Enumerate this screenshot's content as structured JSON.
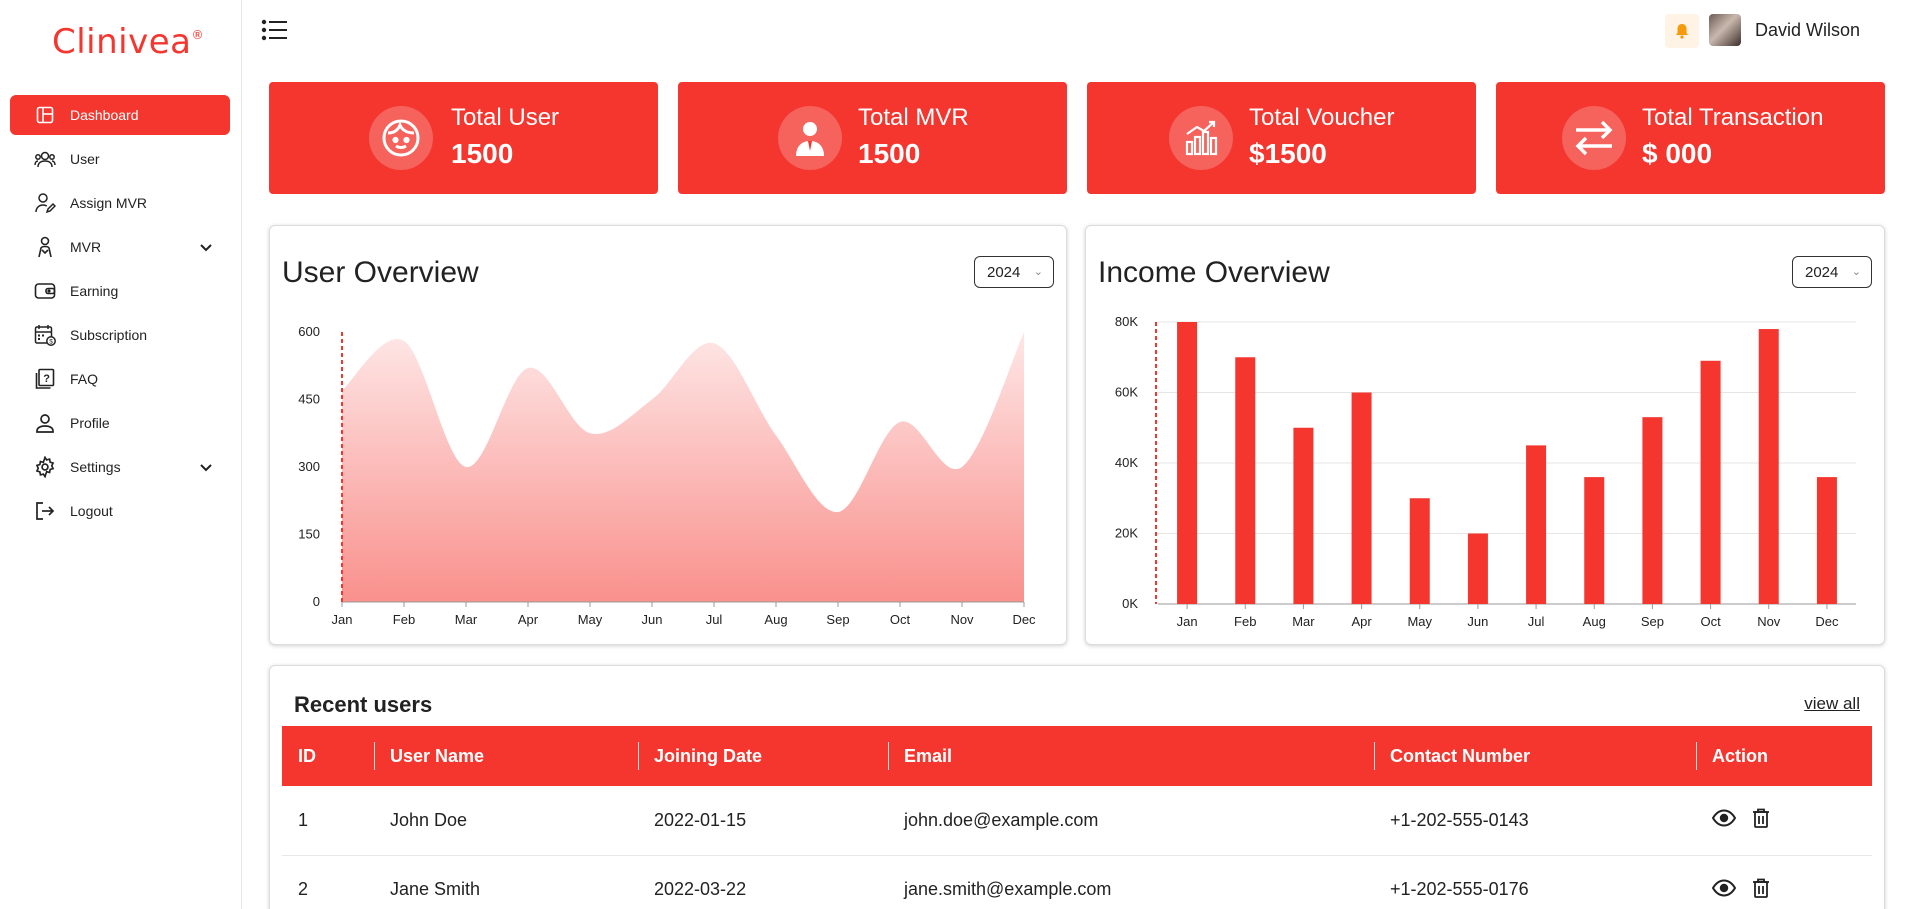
{
  "app": {
    "logo": "Clinivea",
    "logo_mark": "®"
  },
  "sidebar": {
    "items": [
      {
        "label": "Dashboard",
        "icon": "dashboard-icon",
        "active": true
      },
      {
        "label": "User",
        "icon": "users-icon"
      },
      {
        "label": "Assign MVR",
        "icon": "user-edit-icon"
      },
      {
        "label": "MVR",
        "icon": "person-icon",
        "expandable": true
      },
      {
        "label": "Earning",
        "icon": "wallet-icon"
      },
      {
        "label": "Subscription",
        "icon": "calendar-icon"
      },
      {
        "label": "FAQ",
        "icon": "help-book-icon"
      },
      {
        "label": "Profile",
        "icon": "profile-icon"
      },
      {
        "label": "Settings",
        "icon": "gear-icon",
        "expandable": true
      },
      {
        "label": "Logout",
        "icon": "logout-icon"
      }
    ]
  },
  "header": {
    "user_name": "David Wilson"
  },
  "stats": [
    {
      "label": "Total User",
      "value": "1500",
      "icon": "face-icon"
    },
    {
      "label": "Total MVR",
      "value": "1500",
      "icon": "businessman-icon"
    },
    {
      "label": "Total Voucher",
      "value": "$1500",
      "icon": "growth-chart-icon"
    },
    {
      "label": "Total Transaction",
      "value": "$ 000",
      "icon": "transfer-arrows-icon"
    }
  ],
  "user_overview": {
    "title": "User Overview",
    "year": "2024"
  },
  "income_overview": {
    "title": "Income Overview",
    "year": "2024"
  },
  "chart_data": [
    {
      "type": "area",
      "title": "User Overview",
      "x": [
        "Jan",
        "Feb",
        "Mar",
        "Apr",
        "May",
        "Jun",
        "Jul",
        "Aug",
        "Sep",
        "Oct",
        "Nov",
        "Dec"
      ],
      "values": [
        470,
        580,
        300,
        520,
        375,
        450,
        575,
        370,
        200,
        400,
        300,
        600
      ],
      "yticks": [
        "0",
        "150",
        "300",
        "450",
        "600"
      ],
      "ylim": [
        0,
        600
      ],
      "color": "#f4362f"
    },
    {
      "type": "bar",
      "title": "Income Overview",
      "categories": [
        "Jan",
        "Feb",
        "Mar",
        "Apr",
        "May",
        "Jun",
        "Jul",
        "Aug",
        "Sep",
        "Oct",
        "Nov",
        "Dec"
      ],
      "values": [
        80000,
        70000,
        50000,
        60000,
        30000,
        20000,
        45000,
        36000,
        53000,
        69000,
        78000,
        36000
      ],
      "yticks": [
        "0K",
        "20K",
        "40K",
        "60K",
        "80K"
      ],
      "ylim": [
        0,
        80000
      ],
      "color": "#f4362f"
    }
  ],
  "recent_users": {
    "title": "Recent users",
    "view_all": "view all",
    "columns": [
      "ID",
      "User Name",
      "Joining Date",
      "Email",
      "Contact Number",
      "Action"
    ],
    "rows": [
      [
        "1",
        "John Doe",
        "2022-01-15",
        "john.doe@example.com",
        "+1-202-555-0143"
      ],
      [
        "2",
        "Jane Smith",
        "2022-03-22",
        "jane.smith@example.com",
        "+1-202-555-0176"
      ]
    ]
  }
}
